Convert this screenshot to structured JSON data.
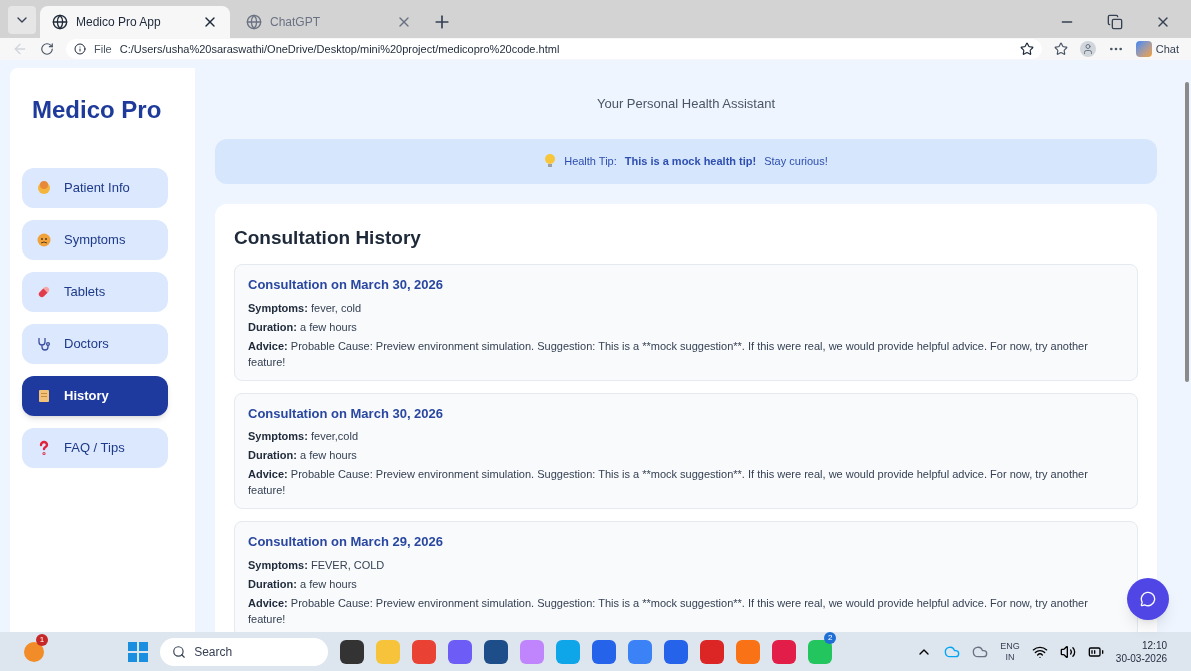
{
  "browser": {
    "tabs": [
      {
        "title": "Medico Pro App",
        "selected": true
      },
      {
        "title": "ChatGPT",
        "selected": false
      }
    ],
    "address": {
      "scheme": "File",
      "url": "C:/Users/usha%20saraswathi/OneDrive/Desktop/mini%20project/medicopro%20code.html"
    },
    "chat_button": "Chat"
  },
  "app": {
    "title": "Medico Pro",
    "subtitle": "Your Personal Health Assistant",
    "nav": [
      {
        "label": "Patient Info",
        "kind": "face",
        "selected": false
      },
      {
        "label": "Symptoms",
        "kind": "sick",
        "selected": false
      },
      {
        "label": "Tablets",
        "kind": "pill",
        "selected": false
      },
      {
        "label": "Doctors",
        "kind": "stethoscope",
        "selected": false
      },
      {
        "label": "History",
        "kind": "scroll",
        "selected": true
      },
      {
        "label": "FAQ / Tips",
        "kind": "question",
        "selected": false
      }
    ],
    "tip": {
      "label": "Health Tip:",
      "text": "This is a mock health tip!",
      "note": "Stay curious!"
    },
    "history": {
      "heading": "Consultation History",
      "entries": [
        {
          "title": "Consultation on March 30, 2026",
          "fields": [
            {
              "label": "Symptoms:",
              "value": "fever, cold"
            },
            {
              "label": "Duration:",
              "value": "a few hours"
            },
            {
              "label": "Advice:",
              "value": "Probable Cause: Preview environment simulation. Suggestion: This is a **mock suggestion**. If this were real, we would provide helpful advice. For now, try another feature!"
            }
          ]
        },
        {
          "title": "Consultation on March 30, 2026",
          "fields": [
            {
              "label": "Symptoms:",
              "value": "fever,cold"
            },
            {
              "label": "Duration:",
              "value": "a few hours"
            },
            {
              "label": "Advice:",
              "value": "Probable Cause: Preview environment simulation. Suggestion: This is a **mock suggestion**. If this were real, we would provide helpful advice. For now, try another feature!"
            }
          ]
        },
        {
          "title": "Consultation on March 29, 2026",
          "fields": [
            {
              "label": "Symptoms:",
              "value": "FEVER, COLD"
            },
            {
              "label": "Duration:",
              "value": "a few hours"
            },
            {
              "label": "Advice:",
              "value": "Probable Cause: Preview environment simulation. Suggestion: This is a **mock suggestion**. If this were real, we would provide helpful advice. For now, try another feature!"
            }
          ]
        }
      ]
    }
  },
  "taskbar": {
    "notification_badge": "1",
    "search_placeholder": "Search",
    "app_badge": "2",
    "language": "ENG",
    "region": "IN",
    "time": "12:10",
    "date": "30-03-2026"
  }
}
